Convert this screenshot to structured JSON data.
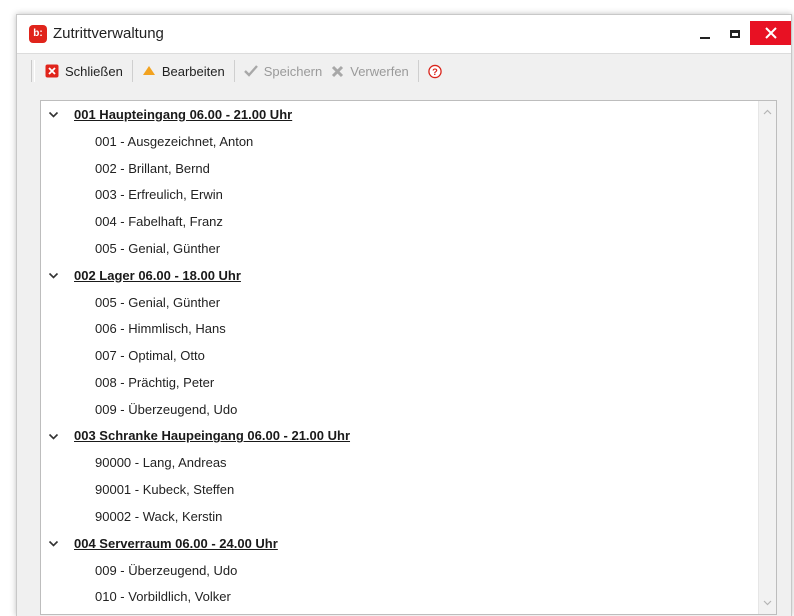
{
  "window": {
    "title": "Zutrittverwaltung",
    "app_icon_text": "b:",
    "accent_color": "#e0241b"
  },
  "toolbar": {
    "close_label": "Schließen",
    "edit_label": "Bearbeiten",
    "save_label": "Speichern",
    "discard_label": "Verwerfen"
  },
  "tree": {
    "groups": [
      {
        "label": "001 Haupteingang 06.00 - 21.00 Uhr",
        "items": [
          "001 - Ausgezeichnet, Anton",
          "002 - Brillant, Bernd",
          "003 - Erfreulich, Erwin",
          "004 - Fabelhaft, Franz",
          "005 - Genial, Günther"
        ]
      },
      {
        "label": "002 Lager 06.00 - 18.00 Uhr",
        "items": [
          "005 - Genial, Günther",
          "006 - Himmlisch, Hans",
          "007 - Optimal, Otto",
          "008 - Prächtig, Peter",
          "009 - Überzeugend, Udo"
        ]
      },
      {
        "label": "003 Schranke Haupeingang 06.00 - 21.00 Uhr",
        "items": [
          "90000 - Lang, Andreas",
          "90001 - Kubeck, Steffen",
          "90002 - Wack, Kerstin"
        ]
      },
      {
        "label": "004 Serverraum 06.00 - 24.00 Uhr",
        "items": [
          "009 - Überzeugend, Udo",
          "010 - Vorbildlich, Volker"
        ]
      }
    ]
  }
}
